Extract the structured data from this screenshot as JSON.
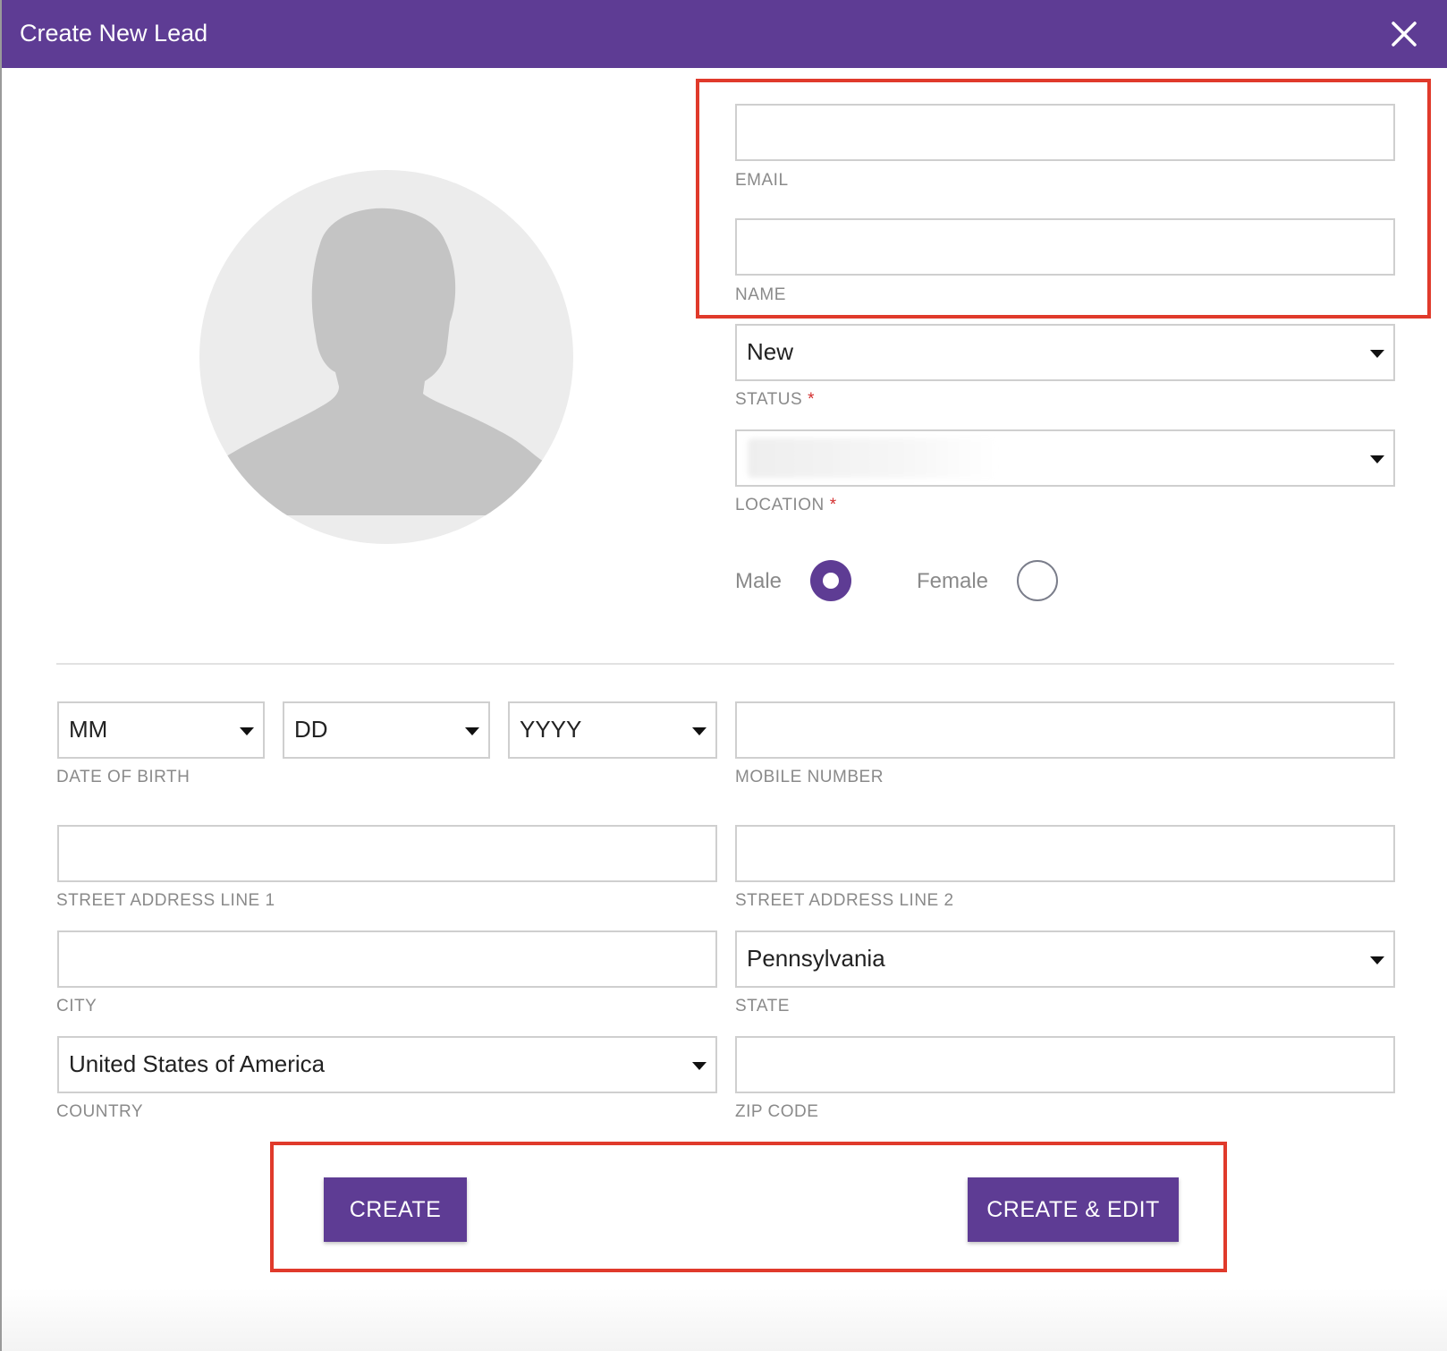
{
  "dialog": {
    "title": "Create New Lead"
  },
  "form": {
    "email": {
      "label": "EMAIL",
      "value": ""
    },
    "name": {
      "label": "NAME",
      "value": ""
    },
    "status": {
      "label": "STATUS",
      "required_mark": "*",
      "selected": "New"
    },
    "location": {
      "label": "LOCATION",
      "required_mark": "*",
      "selected": ""
    },
    "gender": {
      "options": [
        {
          "label": "Male",
          "selected": true
        },
        {
          "label": "Female",
          "selected": false
        }
      ]
    },
    "dob": {
      "label": "DATE OF BIRTH",
      "month": "MM",
      "day": "DD",
      "year": "YYYY"
    },
    "mobile": {
      "label": "MOBILE NUMBER",
      "value": ""
    },
    "street1": {
      "label": "STREET ADDRESS LINE 1",
      "value": ""
    },
    "street2": {
      "label": "STREET ADDRESS LINE 2",
      "value": ""
    },
    "city": {
      "label": "CITY",
      "value": ""
    },
    "state": {
      "label": "STATE",
      "selected": "Pennsylvania"
    },
    "country": {
      "label": "COUNTRY",
      "selected": "United States of America"
    },
    "zip": {
      "label": "ZIP CODE",
      "value": ""
    }
  },
  "actions": {
    "create": "CREATE",
    "create_edit": "CREATE & EDIT"
  },
  "colors": {
    "header": "#5e3c94",
    "accent": "#5e3c94",
    "highlight": "#e03a2b"
  },
  "icons": {
    "close": "close-icon",
    "dropdown": "caret-down-icon",
    "avatar": "person-silhouette-icon"
  }
}
